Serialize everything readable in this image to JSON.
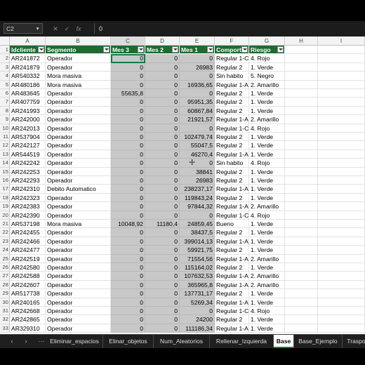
{
  "formula_bar": {
    "name_box": "C2",
    "cancel_icon": "✕",
    "enter_icon": "✓",
    "fx_label": "fx",
    "value": "0"
  },
  "columns": [
    "A",
    "B",
    "C",
    "D",
    "E",
    "F",
    "G",
    "H",
    "I"
  ],
  "headers": [
    "Idcliente",
    "Segmento",
    "Mes 3",
    "Mes 2",
    "Mes 1",
    "Comporta",
    "Riesgo"
  ],
  "rows": [
    [
      "AR241872",
      "Operador",
      "0",
      "0",
      "0",
      "Regular 1-C",
      "4. Rojo"
    ],
    [
      "AR241879",
      "Operador",
      "0",
      "0",
      "26983",
      "Regular 2",
      "1. Verde"
    ],
    [
      "AR540332",
      "Mora masiva",
      "0",
      "0",
      "0",
      "Sin habito",
      "5. Negro"
    ],
    [
      "AR480186",
      "Mora masiva",
      "0",
      "0",
      "16936,65",
      "Regular 1-A",
      "2. Amarillo"
    ],
    [
      "AR483645",
      "Operador",
      "55635,8",
      "0",
      "0",
      "Regular 2",
      "1. Verde"
    ],
    [
      "AR407759",
      "Operador",
      "0",
      "0",
      "95951,35",
      "Regular 2",
      "1. Verde"
    ],
    [
      "AR241993",
      "Operador",
      "0",
      "0",
      "60867,84",
      "Regular 2",
      "1. Verde"
    ],
    [
      "AR242000",
      "Operador",
      "0",
      "0",
      "21921,57",
      "Regular 1-A",
      "2. Amarillo"
    ],
    [
      "AR242013",
      "Operador",
      "0",
      "0",
      "0",
      "Regular 1-C",
      "4. Rojo"
    ],
    [
      "AR537904",
      "Operador",
      "0",
      "0",
      "102479,74",
      "Regular 2",
      "1. Verde"
    ],
    [
      "AR242127",
      "Operador",
      "0",
      "0",
      "55047,5",
      "Regular 2",
      "1. Verde"
    ],
    [
      "AR544519",
      "Operador",
      "0",
      "0",
      "46270,4",
      "Regular 1-A",
      "1. Verde"
    ],
    [
      "AR242242",
      "Operador",
      "0",
      "0",
      "0",
      "Sin habito",
      "4. Rojo"
    ],
    [
      "AR242253",
      "Operador",
      "0",
      "0",
      "38841",
      "Regular 2",
      "1. Verde"
    ],
    [
      "AR242293",
      "Operador",
      "0",
      "0",
      "26983",
      "Regular 2",
      "1. Verde"
    ],
    [
      "AR242310",
      "Debito Automatico",
      "0",
      "0",
      "238237,17",
      "Regular 1-A",
      "1. Verde"
    ],
    [
      "AR242323",
      "Operador",
      "0",
      "0",
      "119843,24",
      "Regular 2",
      "1. Verde"
    ],
    [
      "AR242383",
      "Operador",
      "0",
      "0",
      "97844,32",
      "Regular 1-A",
      "2. Amarillo"
    ],
    [
      "AR242390",
      "Operador",
      "0",
      "0",
      "0",
      "Regular 1-C",
      "4. Rojo"
    ],
    [
      "AR537198",
      "Mora masiva",
      "10048,92",
      "11180,4",
      "24859,45",
      "Bueno",
      "1. Verde"
    ],
    [
      "AR242455",
      "Operador",
      "0",
      "0",
      "38437,5",
      "Regular 2",
      "1. Verde"
    ],
    [
      "AR242466",
      "Operador",
      "0",
      "0",
      "399014,13",
      "Regular 1-A",
      "1. Verde"
    ],
    [
      "AR242477",
      "Operador",
      "0",
      "0",
      "59921,75",
      "Regular 2",
      "1. Verde"
    ],
    [
      "AR242519",
      "Operador",
      "0",
      "0",
      "71554,56",
      "Regular 1-A",
      "2. Amarillo"
    ],
    [
      "AR242580",
      "Operador",
      "0",
      "0",
      "115164,02",
      "Regular 2",
      "1. Verde"
    ],
    [
      "AR242588",
      "Operador",
      "0",
      "0",
      "107632,53",
      "Regular 1-A",
      "2. Amarillo"
    ],
    [
      "AR242607",
      "Operador",
      "0",
      "0",
      "365965,8",
      "Regular 1-A",
      "2. Amarillo"
    ],
    [
      "AR517738",
      "Operador",
      "0",
      "0",
      "137731,17",
      "Regular 2",
      "1. Verde"
    ],
    [
      "AR240165",
      "Operador",
      "0",
      "0",
      "5269,34",
      "Regular 1-A",
      "1. Verde"
    ],
    [
      "AR242668",
      "Operador",
      "0",
      "0",
      "0",
      "Regular 1-C",
      "4. Rojo"
    ],
    [
      "AR242865",
      "Operador",
      "0",
      "0",
      "24200",
      "Regular 2",
      "1. Verde"
    ],
    [
      "AR329310",
      "Operador",
      "0",
      "0",
      "111186,34",
      "Regular 1-A",
      "1. Verde"
    ]
  ],
  "sheet_nav": {
    "prev": "‹",
    "next": "›",
    "more": "···"
  },
  "tabs": [
    "Eliminar_espacios",
    "Elinar_objetos",
    "Num_Aleatorios",
    "Rellenar_Izquierda",
    "Base",
    "Base_Ejemplo",
    "Traspo"
  ],
  "active_tab": "Base",
  "colors": {
    "header_fill": "#1e6a30",
    "shade_fill": "#c8c8c8",
    "accent": "#107c41"
  }
}
